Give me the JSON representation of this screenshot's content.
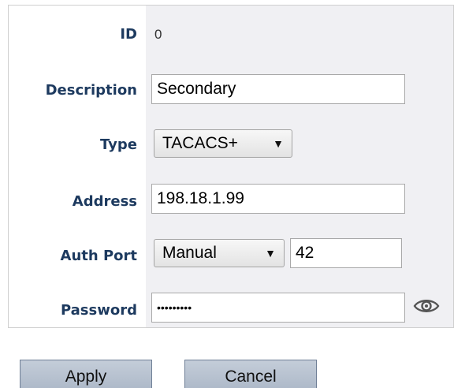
{
  "form": {
    "id_label": "ID",
    "id_value": "0",
    "description_label": "Description",
    "description_value": "Secondary",
    "type_label": "Type",
    "type_value": "TACACS+",
    "address_label": "Address",
    "address_value": "198.18.1.99",
    "auth_port_label": "Auth Port",
    "auth_port_mode": "Manual",
    "auth_port_value": "42",
    "password_label": "Password",
    "password_value": "•••••••••"
  },
  "icons": {
    "select_arrow": "▼",
    "password_toggle": "eye-icon"
  },
  "buttons": {
    "apply_label": "Apply",
    "cancel_label": "Cancel"
  }
}
